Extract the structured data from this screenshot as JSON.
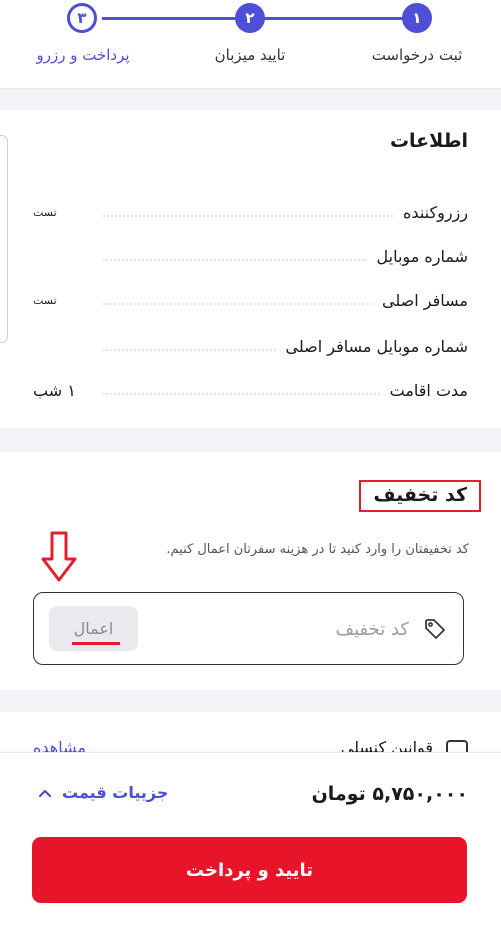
{
  "stepper": {
    "steps": [
      {
        "number": "۱",
        "label": "ثبت درخواست",
        "state": "done"
      },
      {
        "number": "۲",
        "label": "تایید میزبان",
        "state": "done"
      },
      {
        "number": "۳",
        "label": "پرداخت و رزرو",
        "state": "current"
      }
    ],
    "accent_color": "#4d4fd6"
  },
  "info": {
    "title": "اطلاعات",
    "rows": [
      {
        "label": "رزروکننده",
        "value": "تست"
      },
      {
        "label": "شماره موبایل",
        "value": ""
      },
      {
        "label": "مسافر اصلی",
        "value": "تست"
      },
      {
        "label": "شماره موبایل مسافر اصلی",
        "value": ""
      },
      {
        "label": "مدت اقامت",
        "value": "۱ شب"
      }
    ]
  },
  "discount": {
    "title": "کد تخفیف",
    "help_text": "کد تخفیفتان را وارد کنید تا در هزینه سفرتان اعمال کنیم.",
    "input_placeholder": "کد تخفیف",
    "input_value": "",
    "apply_label": "اعمال",
    "highlight_color": "#e41e2f"
  },
  "rules": {
    "checkbox_label": "قوانین کنسلی",
    "link_label": "مشاهده"
  },
  "footer": {
    "price": "۵,۷۵۰,۰۰۰ تومان",
    "price_details_label": "جزییات قیمت",
    "confirm_label": "تایید و پرداخت",
    "confirm_color": "#e8152a"
  }
}
